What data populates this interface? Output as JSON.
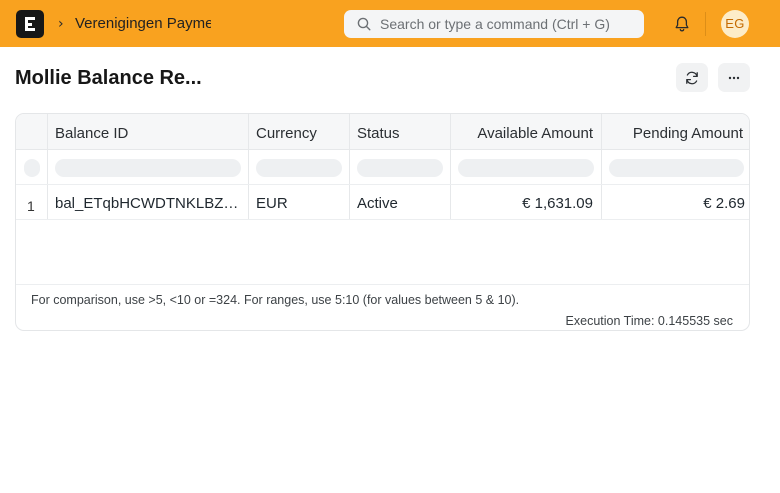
{
  "navbar": {
    "breadcrumb": "Verenigingen Payme",
    "search_placeholder": "Search or type a command (Ctrl + G)",
    "avatar_initials": "EG",
    "icons": [
      "app-logo-icon",
      "chevron-right-icon",
      "search-icon",
      "bell-icon"
    ]
  },
  "page": {
    "title": "Mollie Balance Re..."
  },
  "actions": {
    "icons": [
      "refresh-icon",
      "more-icon"
    ]
  },
  "report": {
    "columns": [
      "Balance ID",
      "Currency",
      "Status",
      "Available Amount",
      "Pending Amount"
    ],
    "rows": [
      {
        "index": "1",
        "balance_id": "bal_ETqbHCWDTNKLBZL...",
        "currency": "EUR",
        "status": "Active",
        "available_amount": "€ 1,631.09",
        "pending_amount": "€ 2.69"
      }
    ],
    "filter_hint": "For comparison, use >5, <10 or =324. For ranges, use 5:10 (for values between 5 & 10).",
    "execution_time": "Execution Time: 0.145535 sec"
  },
  "colors": {
    "navbar_bg": "#f9a21f",
    "logo_bg": "#171717",
    "avatar_bg": "#fdecc8"
  }
}
